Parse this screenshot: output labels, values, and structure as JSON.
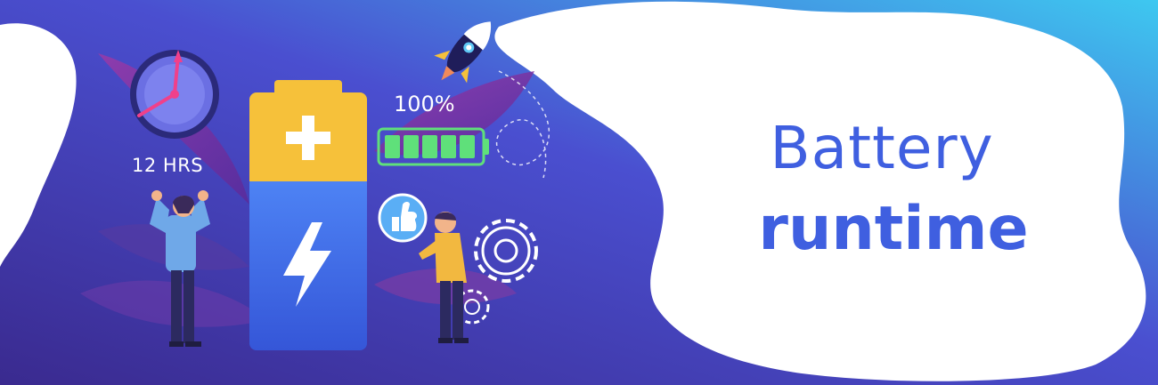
{
  "clock": {
    "label": "12 HRS"
  },
  "charge": {
    "label": "100%",
    "level": 1.0,
    "segments": 5
  },
  "headline": {
    "line1": "Battery",
    "line2": "runtime"
  },
  "colors": {
    "background_dark": "#3a2a8f",
    "background_light": "#4f6df0",
    "battery_top": "#f6c13a",
    "battery_body": "#3f6fe8",
    "accent_green": "#5fe07a",
    "text_primary": "#3f5fe0",
    "leaf": "#8a3aa0"
  },
  "icons": [
    "clock-icon",
    "battery-icon",
    "rocket-icon",
    "gear-icon",
    "thumbs-up-icon",
    "lightning-icon",
    "plus-icon"
  ]
}
